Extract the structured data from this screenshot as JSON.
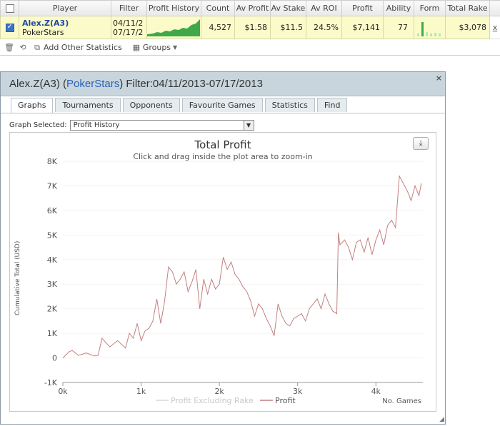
{
  "table": {
    "headers": [
      "Player",
      "Filter",
      "Profit History",
      "Count",
      "Av Profit",
      "Av Stake",
      "Av ROI",
      "Profit",
      "Ability",
      "Form",
      "Total Rake"
    ],
    "row": {
      "player_name": "Alex.Z(A3)",
      "site": "PokerStars",
      "filter_line1": "04/11/2",
      "filter_line2": "07/17/2",
      "count": "4,527",
      "av_profit": "$1.58",
      "av_stake": "$11.5",
      "av_roi": "24.5%",
      "profit": "$7,141",
      "ability": "77",
      "total_rake": "$3,078",
      "remove_glyph": "x"
    }
  },
  "toolbar": {
    "add_stats_label": "Add Other Statistics",
    "groups_label": "Groups"
  },
  "panel": {
    "title_name": "Alex.Z(A3) (",
    "title_site": "PokerStars",
    "title_filter": ") Filter:04/11/2013-07/17/2013",
    "close_glyph": "×",
    "tabs": [
      "Graphs",
      "Tournaments",
      "Opponents",
      "Favourite Games",
      "Statistics",
      "Find"
    ],
    "graph_selected_label": "Graph Selected:",
    "graph_selected_value": "Profit History"
  },
  "colors": {
    "accent_blue": "#2a62b6",
    "row_highlight": "#fbfbc9",
    "profit_line": "#c47f7f",
    "excl_rake_line": "#d8d8d8",
    "sparkline": "#3fa84a"
  },
  "chart_data": {
    "type": "line",
    "title": "Total Profit",
    "subtitle": "Click and drag inside the plot area to zoom-in",
    "xlabel": "No. Games",
    "ylabel": "Cumulative Total (USD)",
    "xlim": [
      0,
      4600
    ],
    "ylim": [
      -1000,
      8000
    ],
    "xticks": [
      0,
      1000,
      2000,
      3000,
      4000
    ],
    "xtick_labels": [
      "0k",
      "1k",
      "2k",
      "3k",
      "4k"
    ],
    "yticks": [
      -1000,
      0,
      1000,
      2000,
      3000,
      4000,
      5000,
      6000,
      7000,
      8000
    ],
    "ytick_labels": [
      "-1K",
      "0",
      "1K",
      "2K",
      "3K",
      "4K",
      "5K",
      "6K",
      "7K",
      "8K"
    ],
    "legend_position": "bottom",
    "series": [
      {
        "name": "Profit Excluding Rake",
        "x": [],
        "y": []
      },
      {
        "name": "Profit",
        "x": [
          0,
          80,
          120,
          200,
          300,
          400,
          450,
          500,
          600,
          700,
          800,
          850,
          900,
          950,
          1000,
          1050,
          1100,
          1150,
          1200,
          1250,
          1300,
          1350,
          1400,
          1450,
          1500,
          1550,
          1600,
          1650,
          1700,
          1750,
          1800,
          1850,
          1900,
          1950,
          2000,
          2050,
          2100,
          2150,
          2200,
          2250,
          2300,
          2350,
          2400,
          2450,
          2500,
          2550,
          2600,
          2650,
          2700,
          2750,
          2800,
          2850,
          2900,
          2950,
          3000,
          3050,
          3100,
          3150,
          3200,
          3250,
          3300,
          3350,
          3400,
          3450,
          3500,
          3520,
          3540,
          3600,
          3650,
          3700,
          3750,
          3800,
          3850,
          3900,
          3950,
          4000,
          4050,
          4100,
          4150,
          4200,
          4250,
          4300,
          4350,
          4400,
          4450,
          4500,
          4550,
          4580
        ],
        "y": [
          0,
          250,
          300,
          100,
          200,
          80,
          100,
          800,
          450,
          700,
          400,
          1000,
          800,
          1400,
          700,
          1100,
          1200,
          1500,
          2400,
          1400,
          2300,
          3700,
          3500,
          3000,
          3200,
          3500,
          2700,
          3100,
          3600,
          2000,
          3200,
          2600,
          3200,
          2800,
          3000,
          4100,
          3600,
          3900,
          3400,
          3200,
          2900,
          2700,
          2300,
          1700,
          2200,
          2000,
          1600,
          1300,
          900,
          2200,
          1700,
          1400,
          1300,
          1600,
          1700,
          1800,
          1500,
          2000,
          2200,
          2400,
          2000,
          2600,
          2200,
          1900,
          1800,
          5100,
          4600,
          4800,
          4500,
          4000,
          4700,
          4800,
          4300,
          4900,
          4200,
          4800,
          5200,
          4600,
          5400,
          5600,
          5300,
          7400,
          7100,
          6800,
          6400,
          7000,
          6600,
          7100
        ]
      }
    ]
  }
}
